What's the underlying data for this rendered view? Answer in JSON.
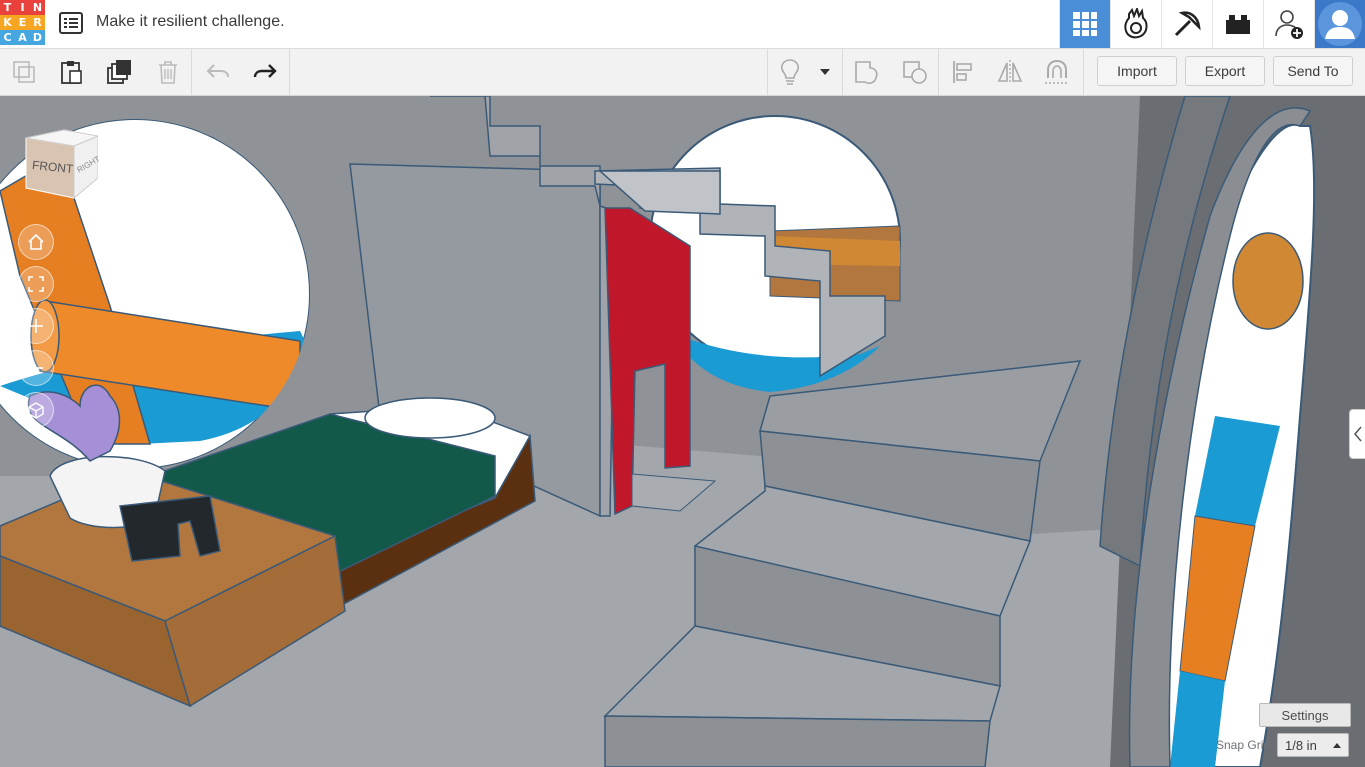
{
  "app": {
    "logo_letters": [
      "T",
      "I",
      "N",
      "K",
      "E",
      "R",
      "C",
      "A",
      "D"
    ],
    "logo_colors": [
      "#e9413c",
      "#e9413c",
      "#e9413c",
      "#f6a623",
      "#f6a623",
      "#f6a623",
      "#45a6e0",
      "#45a6e0",
      "#45a6e0"
    ],
    "design_title": "Make it resilient challenge."
  },
  "topnav": {
    "items": [
      {
        "name": "3d-design-grid-icon",
        "active": true
      },
      {
        "name": "codeblocks-icon",
        "active": false
      },
      {
        "name": "minecraft-pickaxe-icon",
        "active": false
      },
      {
        "name": "lego-brick-icon",
        "active": false
      },
      {
        "name": "add-user-icon",
        "active": false
      },
      {
        "name": "user-avatar-icon",
        "active": false
      }
    ],
    "accent": "#4a8ed8"
  },
  "toolbar": {
    "tools": [
      "copy-icon",
      "paste-icon",
      "duplicate-icon",
      "delete-icon",
      "undo-icon",
      "redo-icon"
    ],
    "right_tools": [
      "note-bulb-icon",
      "dropdown-caret-icon",
      "group-icon",
      "ungroup-icon",
      "align-icon",
      "mirror-icon",
      "magnet-icon"
    ],
    "import_label": "Import",
    "export_label": "Export",
    "send_to_label": "Send To"
  },
  "viewcube": {
    "front_label": "FRONT",
    "right_label": "RIGHT"
  },
  "view_controls": [
    "home-view-icon",
    "fit-view-icon",
    "zoom-in-icon",
    "zoom-out-icon",
    "perspective-icon"
  ],
  "bottom": {
    "settings_label": "Settings",
    "snap_grid_label": "Snap Grid",
    "snap_grid_value": "1/8 in"
  },
  "scene_colors": {
    "floor": "#a3a6aa",
    "wall": "#8f9397",
    "orange": "#e67e22",
    "red_door": "#c0182a",
    "bedspread": "#12594a",
    "wood": "#b2773e",
    "water": "#1a9bd4"
  }
}
